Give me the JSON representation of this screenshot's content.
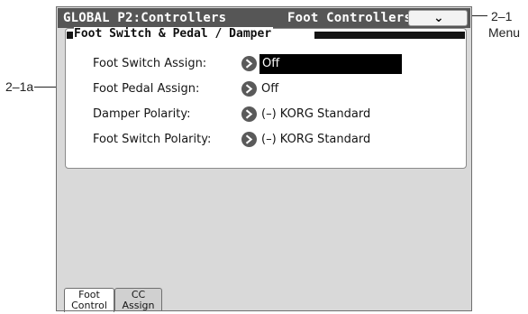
{
  "callouts": {
    "menu_number": "2–1",
    "menu_word": "Menu",
    "left_label": "2–1a"
  },
  "header": {
    "page_title": "GLOBAL P2:Controllers",
    "page_subtitle": "Foot Controllers",
    "menu_icon": "chevron-down-icon"
  },
  "section": {
    "title": "Foot Switch & Pedal / Damper",
    "rows": [
      {
        "label": "Foot Switch Assign:",
        "value": "Off",
        "selected": true,
        "icon": "chevron-right-circle-icon"
      },
      {
        "label": "Foot Pedal Assign:",
        "value": "Off",
        "selected": false,
        "icon": "chevron-right-circle-icon"
      },
      {
        "label": "Damper Polarity:",
        "value": "(–) KORG Standard",
        "selected": false,
        "icon": "chevron-right-circle-icon"
      },
      {
        "label": "Foot Switch Polarity:",
        "value": "(–) KORG Standard",
        "selected": false,
        "icon": "chevron-right-circle-icon"
      }
    ]
  },
  "tabs": [
    {
      "line1": "Foot",
      "line2": "Control",
      "active": true
    },
    {
      "line1": "CC",
      "line2": "Assign",
      "active": false
    }
  ],
  "colors": {
    "title_bar": "#565656",
    "screen_bg": "#d9d9d9",
    "panel_bg": "#ffffff",
    "selected_bg": "#000000",
    "icon_bg": "#5a5a5a"
  }
}
